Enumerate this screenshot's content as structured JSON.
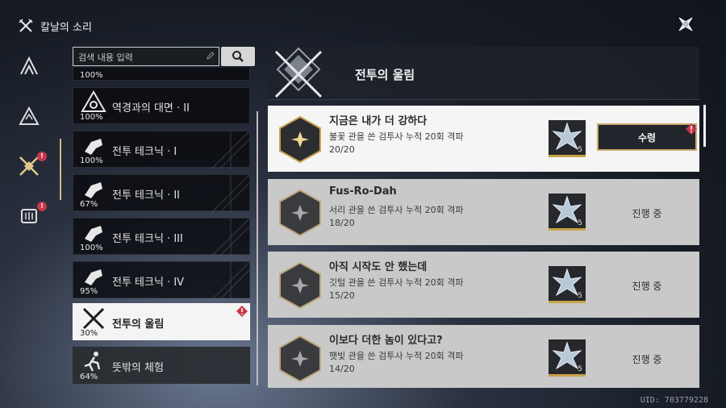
{
  "header": {
    "title": "칼날의 소리"
  },
  "search": {
    "placeholder": "검색 내용 입력"
  },
  "categories": [
    {
      "name": "",
      "percent": "100%"
    },
    {
      "name": "역경과의 대면 · II",
      "percent": "100%"
    },
    {
      "name": "전투 테크닉 · I",
      "percent": "100%"
    },
    {
      "name": "전투 테크닉 · II",
      "percent": "67%"
    },
    {
      "name": "전투 테크닉 · III",
      "percent": "100%"
    },
    {
      "name": "전투 테크닉 · IV",
      "percent": "95%"
    },
    {
      "name": "전투의 울림",
      "percent": "30%"
    },
    {
      "name": "뜻밖의 체험",
      "percent": "64%"
    }
  ],
  "panel": {
    "title": "전투의 울림"
  },
  "achievements": [
    {
      "name": "지금은 내가 더 강하다",
      "desc": "불꽃 관을 쓴 검투사 누적 20회 격파",
      "progress": "20/20",
      "reward_count": "5",
      "status": "수령"
    },
    {
      "name": "Fus-Ro-Dah",
      "desc": "서리 관을 쓴 검투사 누적 20회 격파",
      "progress": "18/20",
      "reward_count": "5",
      "status": "진행 중"
    },
    {
      "name": "아직 시작도 안 했는데",
      "desc": "깃털 관을 쓴 검투사 누적 20회 격파",
      "progress": "15/20",
      "reward_count": "5",
      "status": "진행 중"
    },
    {
      "name": "이보다 더한 놈이 있다고?",
      "desc": "햇빛 관을 쓴 검투사 누적 20회 격파",
      "progress": "14/20",
      "reward_count": "5",
      "status": "진행 중"
    }
  ],
  "uid": "UID: 703779228",
  "colors": {
    "accent_gold": "#c9a24a",
    "alert_red": "#c7364a",
    "active_bg": "#f4f4f4"
  }
}
